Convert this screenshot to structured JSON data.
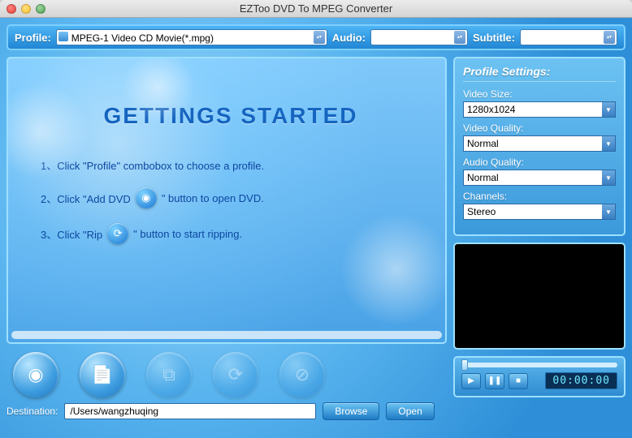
{
  "title": "EZToo DVD To MPEG Converter",
  "toolbar": {
    "profile_label": "Profile:",
    "profile_value": "MPEG-1 Video CD Movie(*.mpg)",
    "audio_label": "Audio:",
    "audio_value": "",
    "subtitle_label": "Subtitle:",
    "subtitle_value": ""
  },
  "gettingStarted": {
    "heading": "GETTINGS STARTED",
    "step1_a": "1、Click \"Profile\" combobox to choose a profile.",
    "step2_a": "2、Click \"Add DVD",
    "step2_b": "\" button to open DVD.",
    "step3_a": "3、Click \"Rip",
    "step3_b": "\" button to start ripping."
  },
  "settings": {
    "heading": "Profile Settings:",
    "videoSize_label": "Video Size:",
    "videoSize_value": "1280x1024",
    "videoQuality_label": "Video Quality:",
    "videoQuality_value": "Normal",
    "audioQuality_label": "Audio Quality:",
    "audioQuality_value": "Normal",
    "channels_label": "Channels:",
    "channels_value": "Stereo"
  },
  "player": {
    "timecode": "00:00:00"
  },
  "bottom": {
    "destination_label": "Destination:",
    "destination_value": "/Users/wangzhuqing",
    "browse_label": "Browse",
    "open_label": "Open"
  }
}
